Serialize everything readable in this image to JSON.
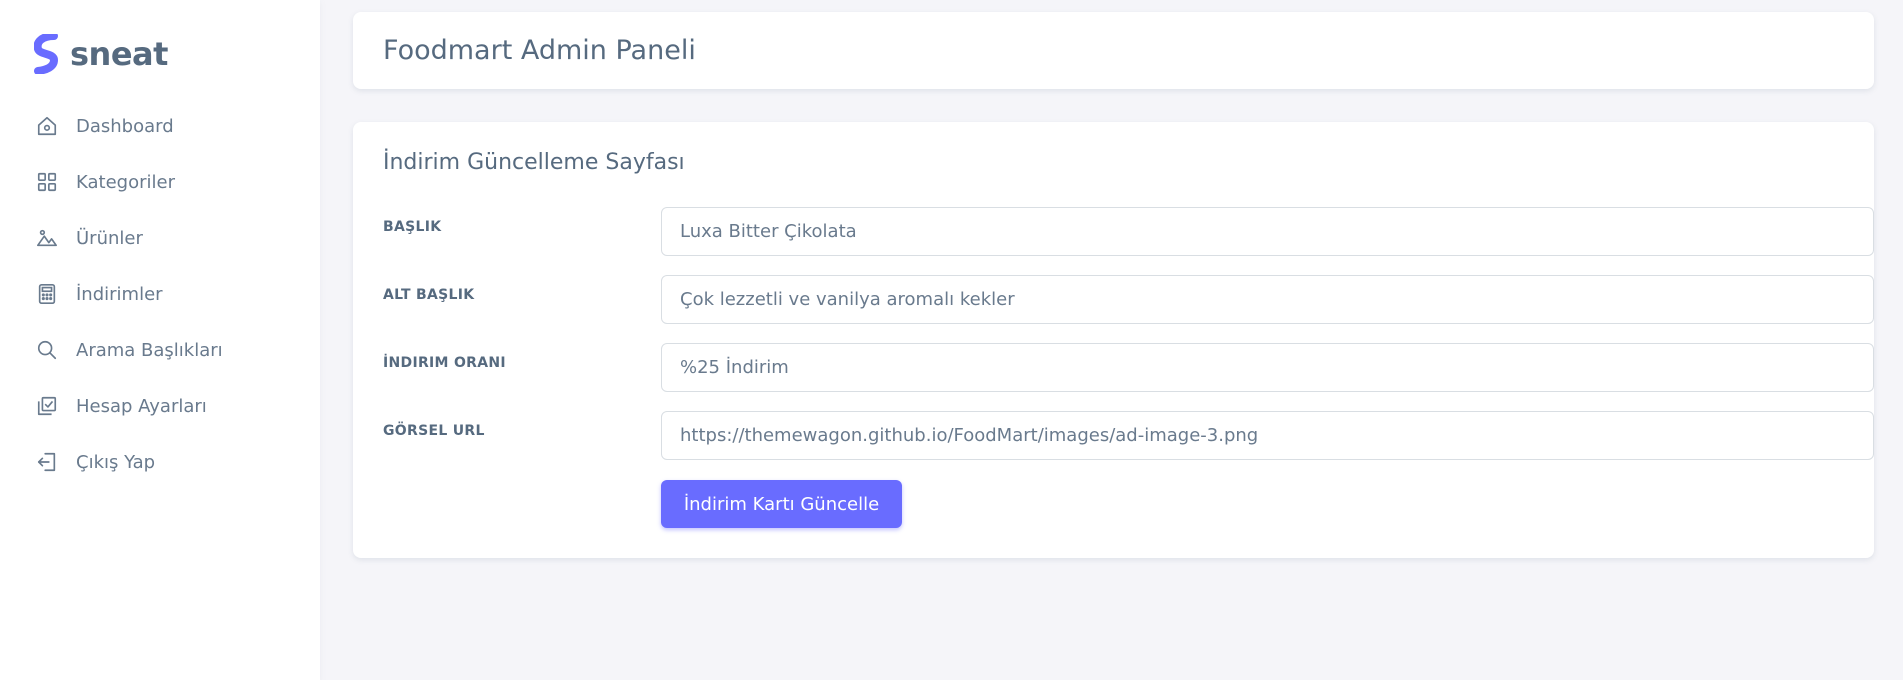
{
  "brand": {
    "name": "sneat",
    "accent_color": "#696cff"
  },
  "sidebar": {
    "items": [
      {
        "label": "Dashboard",
        "icon": "home-icon"
      },
      {
        "label": "Kategoriler",
        "icon": "grid-icon"
      },
      {
        "label": "Ürünler",
        "icon": "image-icon"
      },
      {
        "label": "İndirimler",
        "icon": "calculator-icon"
      },
      {
        "label": "Arama Başlıkları",
        "icon": "search-icon"
      },
      {
        "label": "Hesap Ayarları",
        "icon": "checkbox-icon"
      },
      {
        "label": "Çıkış Yap",
        "icon": "logout-icon"
      }
    ]
  },
  "header": {
    "title": "Foodmart Admin Paneli"
  },
  "form": {
    "title": "İndirim Güncelleme Sayfası",
    "fields": [
      {
        "label": "BAŞLIK",
        "value": "Luxa Bitter Çikolata"
      },
      {
        "label": "ALT BAŞLIK",
        "value": "Çok lezzetli ve vanilya aromalı kekler"
      },
      {
        "label": "İNDIRIM ORANI",
        "value": "%25 İndirim"
      },
      {
        "label": "GÖRSEL URL",
        "value": "https://themewagon.github.io/FoodMart/images/ad-image-3.png"
      }
    ],
    "submit_label": "İndirim Kartı Güncelle"
  }
}
